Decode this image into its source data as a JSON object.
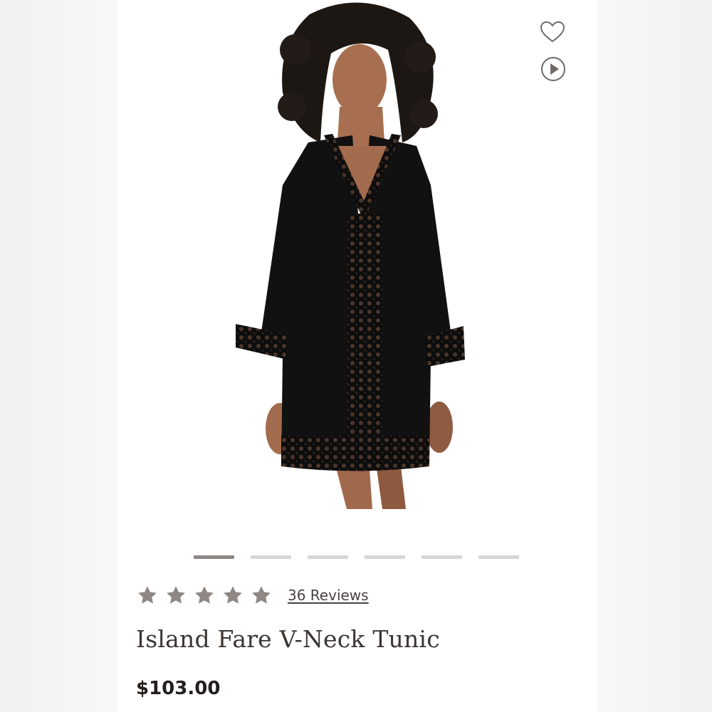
{
  "product": {
    "image_alt": "Model wearing black crochet-trim V-neck tunic",
    "name": "Island Fare V-Neck Tunic",
    "price": "$103.00",
    "rating": {
      "stars": 5,
      "max": 5,
      "reviews_label": "36 Reviews"
    }
  },
  "gallery": {
    "image_count": 6,
    "active_index": 0
  },
  "icons": {
    "wishlist": "heart-icon",
    "video": "play-icon",
    "star": "star-icon"
  },
  "colors": {
    "star": "#8e8784",
    "active_dot": "#8e8784",
    "inactive_dot": "#d9d6d6",
    "title": "#3b3533",
    "price": "#231d1b"
  }
}
